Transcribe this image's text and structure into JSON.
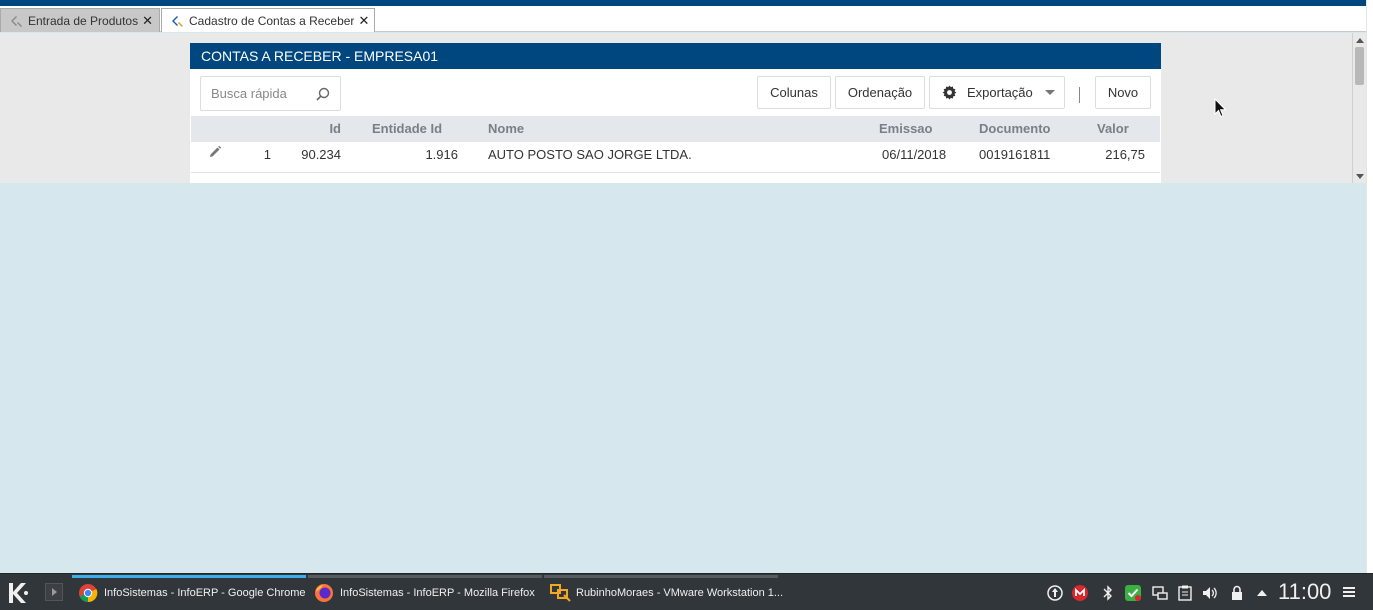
{
  "tabs": [
    {
      "label": "Entrada de Produtos",
      "icon": "app-logo-icon",
      "active": false
    },
    {
      "label": "Cadastro de Contas a Receber",
      "icon": "app-logo-icon",
      "active": true
    }
  ],
  "panel": {
    "title": "CONTAS A RECEBER - EMPRESA01"
  },
  "toolbar": {
    "search_placeholder": "Busca rápida",
    "colunas": "Colunas",
    "ordenacao": "Ordenação",
    "exportacao": "Exportação",
    "novo": "Novo"
  },
  "grid": {
    "columns": [
      "Id",
      "Entidade Id",
      "Nome",
      "Emissao",
      "Documento",
      "Valor"
    ],
    "rows": [
      {
        "n": "1",
        "id": "90.234",
        "entidade": "1.916",
        "nome": "AUTO POSTO SAO JORGE LTDA.",
        "emissao": "06/11/2018",
        "documento": "0019161811",
        "valor": "216,75"
      }
    ]
  },
  "taskbar": {
    "tasks": [
      {
        "label": "InfoSistemas - InfoERP - Google Chrome",
        "icon": "chrome-icon",
        "active": true
      },
      {
        "label": "InfoSistemas - InfoERP - Mozilla Firefox",
        "icon": "firefox-icon",
        "active": false
      },
      {
        "label": "RubinhoMoraes - VMware Workstation 1...",
        "icon": "vmware-icon",
        "active": false
      }
    ],
    "clock": "11:00"
  },
  "colors": {
    "brand": "#00467f",
    "taskbar": "#31363b",
    "background": "#d6e7ed"
  }
}
